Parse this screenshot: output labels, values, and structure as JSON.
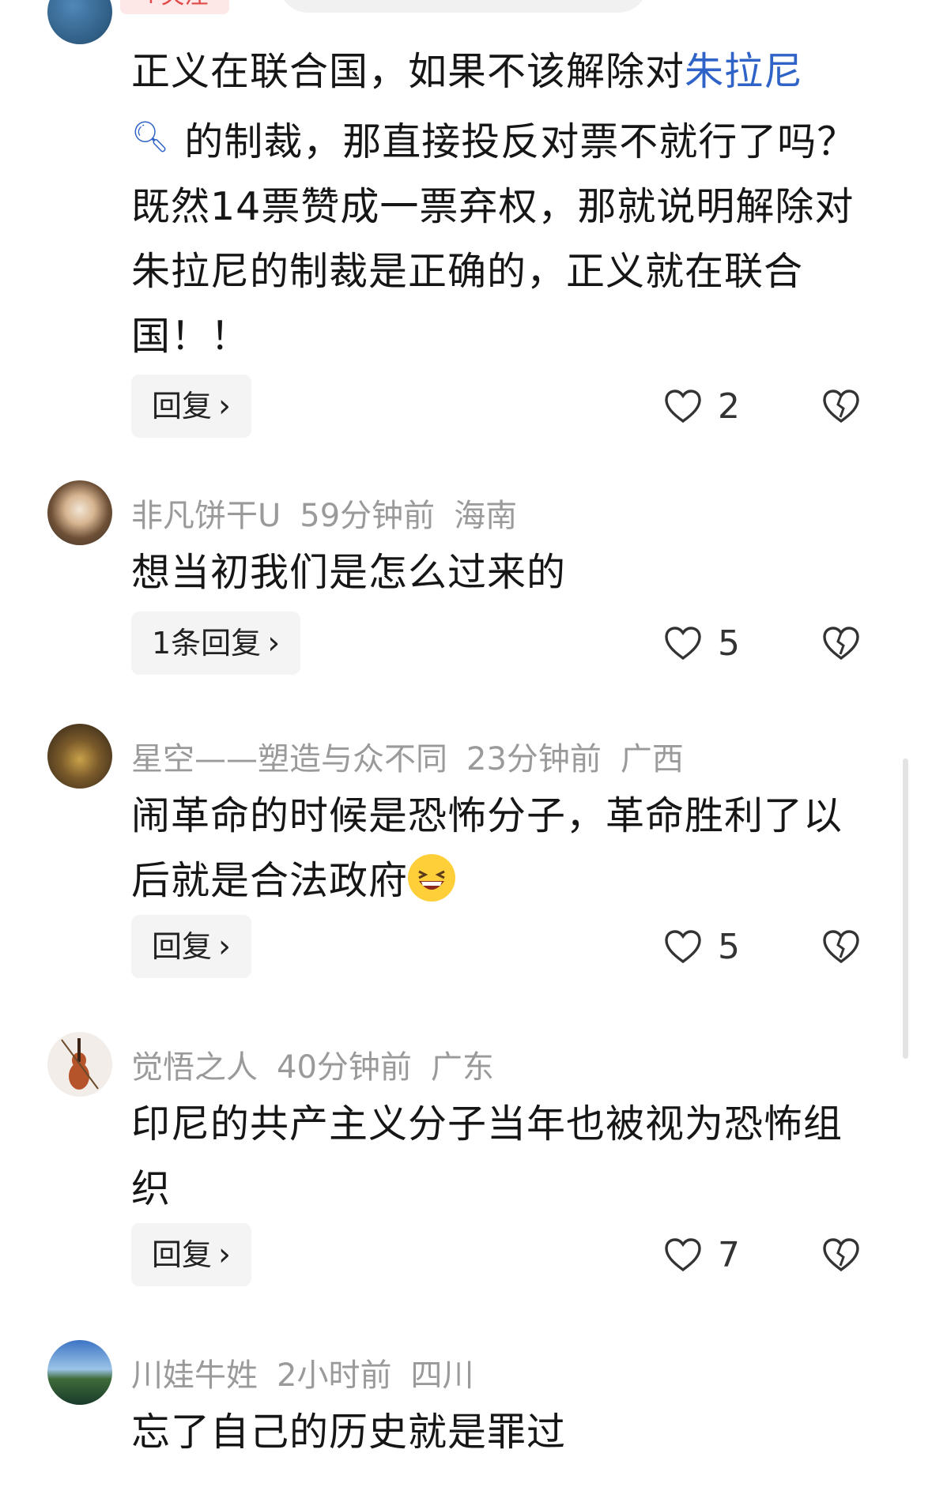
{
  "top": {
    "follow_label": "+关注"
  },
  "comments": [
    {
      "text_before": "正义在联合国，如果不该解除对",
      "link": "朱拉尼",
      "text_after": "的制裁，那直接投反对票不就行了吗？既然14票赞成一票弃权，那就说明解除对朱拉尼的制裁是正确的，正义就在联合国！！",
      "reply_label": "回复",
      "likes": "2"
    },
    {
      "user": "非凡饼干U",
      "time": "59分钟前",
      "location": "海南",
      "text": "想当初我们是怎么过来的",
      "reply_label": "1条回复",
      "likes": "5"
    },
    {
      "user": "星空——塑造与众不同",
      "time": "23分钟前",
      "location": "广西",
      "text": "闹革命的时候是恐怖分子，革命胜利了以后就是合法政府",
      "reply_label": "回复",
      "likes": "5"
    },
    {
      "user": "觉悟之人",
      "time": "40分钟前",
      "location": "广东",
      "text": "印尼的共产主义分子当年也被视为恐怖组织",
      "reply_label": "回复",
      "likes": "7"
    },
    {
      "user": "川娃牛姓",
      "time": "2小时前",
      "location": "四川",
      "text": "忘了自己的历史就是罪过"
    }
  ],
  "colors": {
    "link": "#2f63c7",
    "meta": "#9a9a9a",
    "reply_bg": "#f4f4f4"
  },
  "icons": [
    "search-icon",
    "heart-icon",
    "broken-heart-icon",
    "chevron-right-icon",
    "laughing-emoji"
  ]
}
